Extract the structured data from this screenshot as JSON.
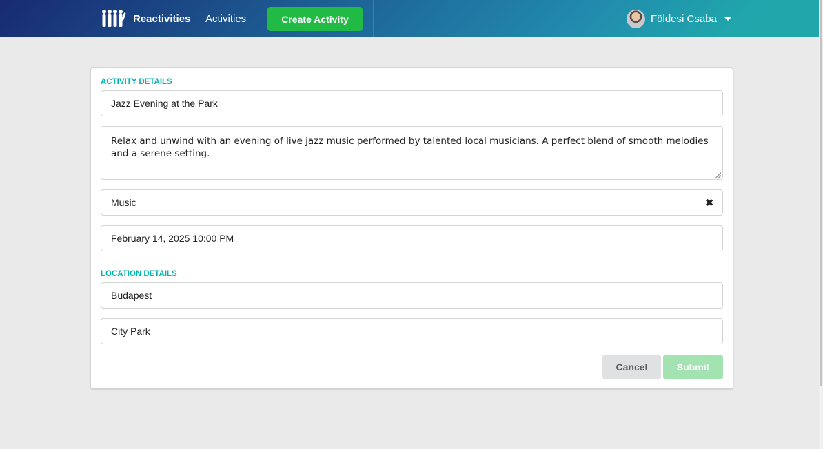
{
  "navbar": {
    "brand": "Reactivities",
    "activities_label": "Activities",
    "create_label": "Create Activity",
    "user_name": "Földesi Csaba"
  },
  "form": {
    "activity_section": "Activity Details",
    "title_value": "Jazz Evening at the Park",
    "description_value": "Relax and unwind with an evening of live jazz music performed by talented local musicians. A perfect blend of smooth melodies and a serene setting.",
    "category_value": "Music",
    "date_value": "February 14, 2025 10:00 PM",
    "location_section": "Location Details",
    "city_value": "Budapest",
    "venue_value": "City Park",
    "cancel_label": "Cancel",
    "submit_label": "Submit"
  },
  "colors": {
    "accent": "#00b5ad",
    "create": "#21ba45",
    "submit_disabled": "#a3e2b1"
  }
}
